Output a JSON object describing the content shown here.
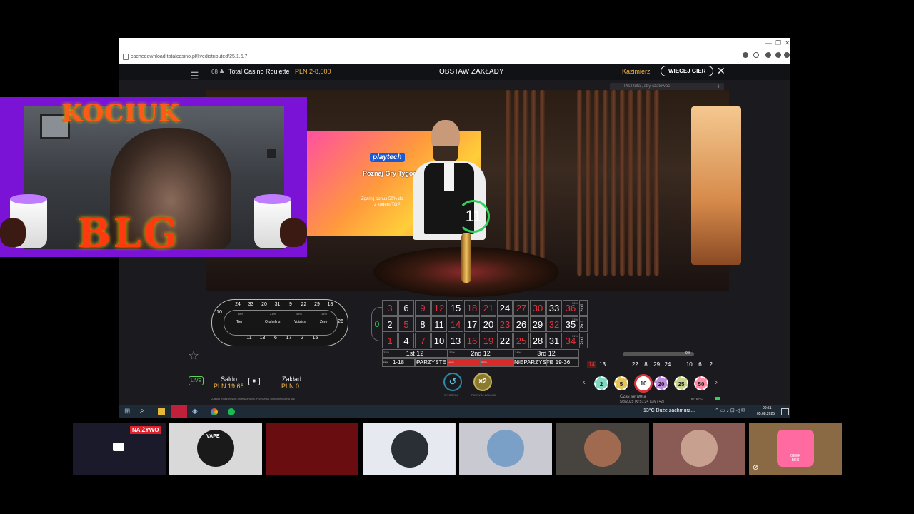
{
  "browser": {
    "url": "cachedownload.totalcasino.pl/livedistributed/25.1.5.7"
  },
  "game": {
    "players_count": "68",
    "player_icon": "person-icon",
    "title": "Total Casino Roulette",
    "limits": "PLN 2-8,000",
    "status": "OBSTAW ZAKŁADY",
    "username": "Kazimierz",
    "more_games_label": "WIĘCEJ GIER",
    "chat_placeholder": "Pisz tutaj, aby czatować",
    "timer": "11",
    "banner_brand": "playtech",
    "banner_headline": "Poznaj Gry Tygodnia",
    "banner_line1": "Zgarnij bonus 50% do",
    "banner_line2": "z kodem TOP"
  },
  "racetrack": {
    "top": [
      "24",
      "33",
      "20",
      "31",
      "9",
      "22",
      "29",
      "18"
    ],
    "bottom": [
      "11",
      "13",
      "6",
      "17",
      "2",
      "15"
    ],
    "left": "10",
    "right": "26",
    "sections": [
      "Tier",
      "Orphelins",
      "Voisins",
      "Zero"
    ],
    "pcts": [
      "58%",
      "21%",
      "45%",
      "15%"
    ]
  },
  "table": {
    "zero": "0",
    "rows": [
      [
        {
          "n": "3",
          "c": "red"
        },
        {
          "n": "6",
          "c": "blk"
        },
        {
          "n": "9",
          "c": "red"
        },
        {
          "n": "12",
          "c": "red"
        },
        {
          "n": "15",
          "c": "blk"
        },
        {
          "n": "18",
          "c": "red"
        },
        {
          "n": "21",
          "c": "red"
        },
        {
          "n": "24",
          "c": "blk"
        },
        {
          "n": "27",
          "c": "red"
        },
        {
          "n": "30",
          "c": "red"
        },
        {
          "n": "33",
          "c": "blk"
        },
        {
          "n": "36",
          "c": "red"
        }
      ],
      [
        {
          "n": "2",
          "c": "blk"
        },
        {
          "n": "5",
          "c": "red"
        },
        {
          "n": "8",
          "c": "blk"
        },
        {
          "n": "11",
          "c": "blk"
        },
        {
          "n": "14",
          "c": "red"
        },
        {
          "n": "17",
          "c": "blk"
        },
        {
          "n": "20",
          "c": "blk"
        },
        {
          "n": "23",
          "c": "red"
        },
        {
          "n": "26",
          "c": "blk"
        },
        {
          "n": "29",
          "c": "blk"
        },
        {
          "n": "32",
          "c": "red"
        },
        {
          "n": "35",
          "c": "blk"
        }
      ],
      [
        {
          "n": "1",
          "c": "red"
        },
        {
          "n": "4",
          "c": "blk"
        },
        {
          "n": "7",
          "c": "red"
        },
        {
          "n": "10",
          "c": "blk"
        },
        {
          "n": "13",
          "c": "blk"
        },
        {
          "n": "16",
          "c": "red"
        },
        {
          "n": "19",
          "c": "red"
        },
        {
          "n": "22",
          "c": "blk"
        },
        {
          "n": "25",
          "c": "red"
        },
        {
          "n": "28",
          "c": "blk"
        },
        {
          "n": "31",
          "c": "blk"
        },
        {
          "n": "34",
          "c": "red"
        }
      ]
    ],
    "columns": [
      "2to1",
      "2to1",
      "2to1"
    ],
    "col_pcts": [
      "36%",
      "33%",
      "31%"
    ],
    "dozens": [
      "1st 12",
      "2nd 12",
      "3rd 12"
    ],
    "dozen_pcts": [
      "32%",
      "32%",
      "34%"
    ],
    "outside": [
      "1-18",
      "PARZYSTE",
      "",
      "",
      "NIEPARZYSTE",
      "19-36"
    ],
    "outside_pcts": [
      "48%",
      "51%",
      "46%",
      "52%",
      "47%",
      "50%"
    ]
  },
  "history": [
    "14",
    "13",
    "",
    "",
    "22",
    "8",
    "29",
    "24",
    "",
    "10",
    "6",
    "2"
  ],
  "history_colors": [
    "red",
    "blk",
    "red",
    "red",
    "blk",
    "blk",
    "blk",
    "blk",
    "red",
    "blk",
    "blk",
    "blk"
  ],
  "hot_cold_pct": "0%",
  "balance": {
    "saldo_label": "Saldo",
    "saldo_value": "PLN 19.66",
    "bet_label": "Zakład",
    "bet_value": "PLN 0",
    "disclaimer": "Zakład może zostać unieważniony. Przeczytaj odpowiedzialną grę"
  },
  "actions": {
    "undo_label": "WYCOFAJ",
    "double_label": "PODWÓJ ZAKŁAD",
    "double_symbol": "×2"
  },
  "chips": [
    "2",
    "5",
    "10",
    "20",
    "25",
    "50"
  ],
  "chip_colors": [
    "#7fd7c4",
    "#e6c45a",
    "#ffffff",
    "#c08ae0",
    "#c9d28a",
    "#ff8aa5"
  ],
  "server": {
    "label": "Czas serwera",
    "time": "5/8/2025 00:51:24 (GMT+2)",
    "clock": "00:00:52"
  },
  "taskbar": {
    "weather": "13°C  Duże zachmurz...",
    "time": "00:51",
    "date": "05.08.2025"
  },
  "overlay": {
    "name_top": "KOCIUK",
    "name_bottom": "BLG"
  },
  "participants": {
    "live_badge": "NA ŻYWO",
    "tiles_bg": [
      "#1a1a2a",
      "#d9d9d9",
      "#6a0d10",
      "#e6eaf0",
      "#c9c9d2",
      "#474440",
      "#8a5a55",
      "#8a6a45"
    ],
    "avatar_colors": [
      "#333",
      "#1a1a1a",
      "#6a0d10",
      "#2a2f36",
      "#7aa0c8",
      "#a06a50",
      "#c8a090",
      "#ff6aa0"
    ],
    "vape_text": "VAPE",
    "geek_text": "GEEK BRR"
  }
}
